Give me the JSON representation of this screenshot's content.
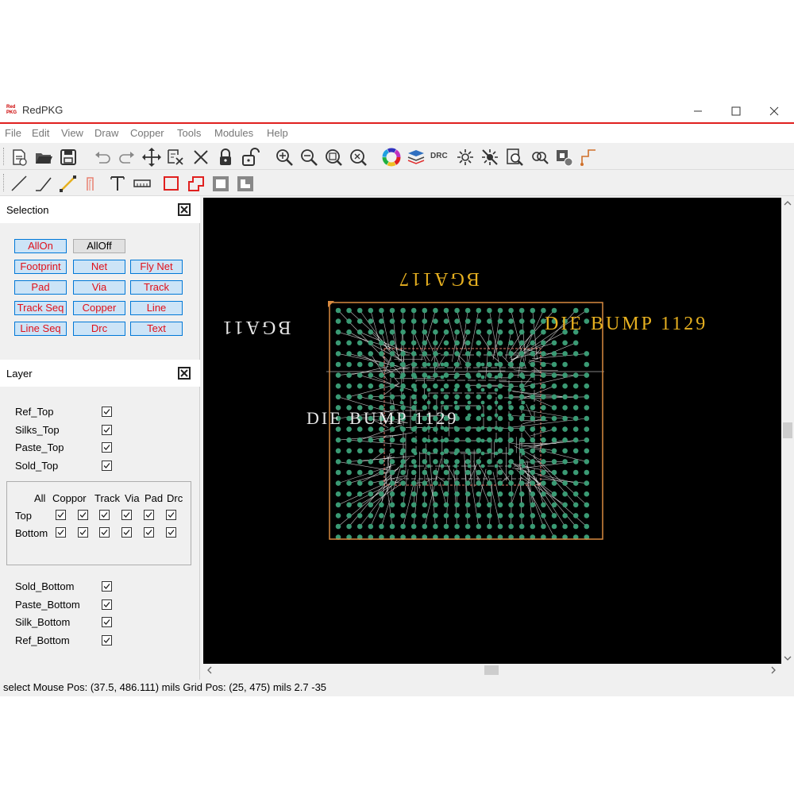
{
  "window": {
    "title": "RedPKG",
    "icon_text": "Red PKG"
  },
  "menu": [
    "File",
    "Edit",
    "View",
    "Draw",
    "Copper",
    "Tools",
    "Modules",
    "Help"
  ],
  "toolbar_drc_label": "DRC",
  "selection": {
    "title": "Selection",
    "buttons": [
      "AllOn",
      "AllOff",
      "Footprint",
      "Net",
      "Fly Net",
      "Pad",
      "Via",
      "Track",
      "Track Seq",
      "Copper",
      "Line",
      "Line Seq",
      "Drc",
      "Text"
    ]
  },
  "layer": {
    "title": "Layer",
    "top_layers": [
      "Ref_Top",
      "Silks_Top",
      "Paste_Top",
      "Sold_Top"
    ],
    "columns": [
      "All",
      "Coppor",
      "Track",
      "Via",
      "Pad",
      "Drc"
    ],
    "rows": [
      "Top",
      "Bottom"
    ],
    "bottom_layers": [
      "Sold_Bottom",
      "Paste_Bottom",
      "Silk_Bottom",
      "Ref_Bottom"
    ]
  },
  "canvas": {
    "label_top": "BGA117",
    "label_left": "BGA11",
    "label_right": "DIE BUMP 1129",
    "label_center": "DIE BUMP 1129"
  },
  "colors": {
    "accent": "#e0201f",
    "pad": "#3a9a74",
    "label": "#e6b020",
    "trace": "#ffffff",
    "outline": "#d88a40"
  },
  "status": "select   Mouse Pos: (37.5, 486.111) mils Grid Pos: (25, 475) mils 2.7 -35"
}
